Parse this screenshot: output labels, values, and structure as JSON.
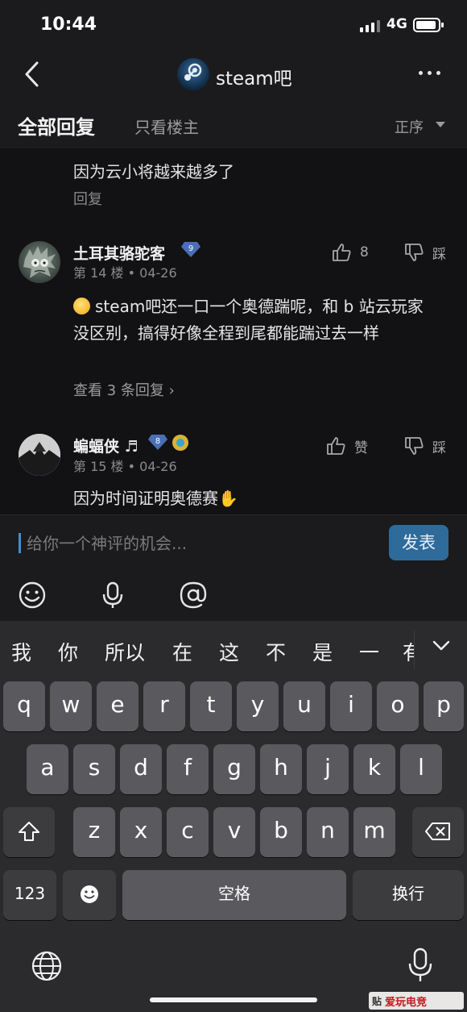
{
  "status_bar": {
    "time": "10:44",
    "network": "4G"
  },
  "nav": {
    "title": "steam吧",
    "forum_avatar_text": "STEAM吧"
  },
  "filter": {
    "all_replies": "全部回复",
    "owner_only": "只看楼主",
    "order": "正序"
  },
  "previous_comment": {
    "text": "因为云小将越来越多了",
    "reply": "回复"
  },
  "comments": [
    {
      "username": "土耳其骆驼客",
      "level": "9",
      "floor": "第 14 楼",
      "date": "04-26",
      "likes": "8",
      "dislike_label": "踩",
      "body": "steam吧还一口一个奥德踹呢，和 b 站云玩家没区别，搞得好像全程到尾都能踹过去一样",
      "view_replies": "查看 3 条回复 ›"
    },
    {
      "username": "蝙蝠侠 ♬",
      "level": "8",
      "floor": "第 15 楼",
      "date": "04-26",
      "likes": "赞",
      "dislike_label": "踩",
      "body": "因为时间证明奥德赛✋"
    }
  ],
  "input": {
    "placeholder": "给你一个神评的机会...",
    "publish": "发表"
  },
  "keyboard": {
    "candidates": [
      "我",
      "你",
      "所以",
      "在",
      "这",
      "不",
      "是",
      "一",
      "有"
    ],
    "row1": [
      "q",
      "w",
      "e",
      "r",
      "t",
      "y",
      "u",
      "i",
      "o",
      "p"
    ],
    "row2": [
      "a",
      "s",
      "d",
      "f",
      "g",
      "h",
      "j",
      "k",
      "l"
    ],
    "row3": [
      "z",
      "x",
      "c",
      "v",
      "b",
      "n",
      "m"
    ],
    "num_key": "123",
    "space": "空格",
    "return": "换行"
  },
  "watermark": {
    "tile": "贴",
    "logo": "爱玩电竞"
  },
  "colors": {
    "accent_blue": "#2f6b9a",
    "badge_blue": "#4a6fb5",
    "background": "#121214",
    "keyboard": "#2b2b2d"
  }
}
